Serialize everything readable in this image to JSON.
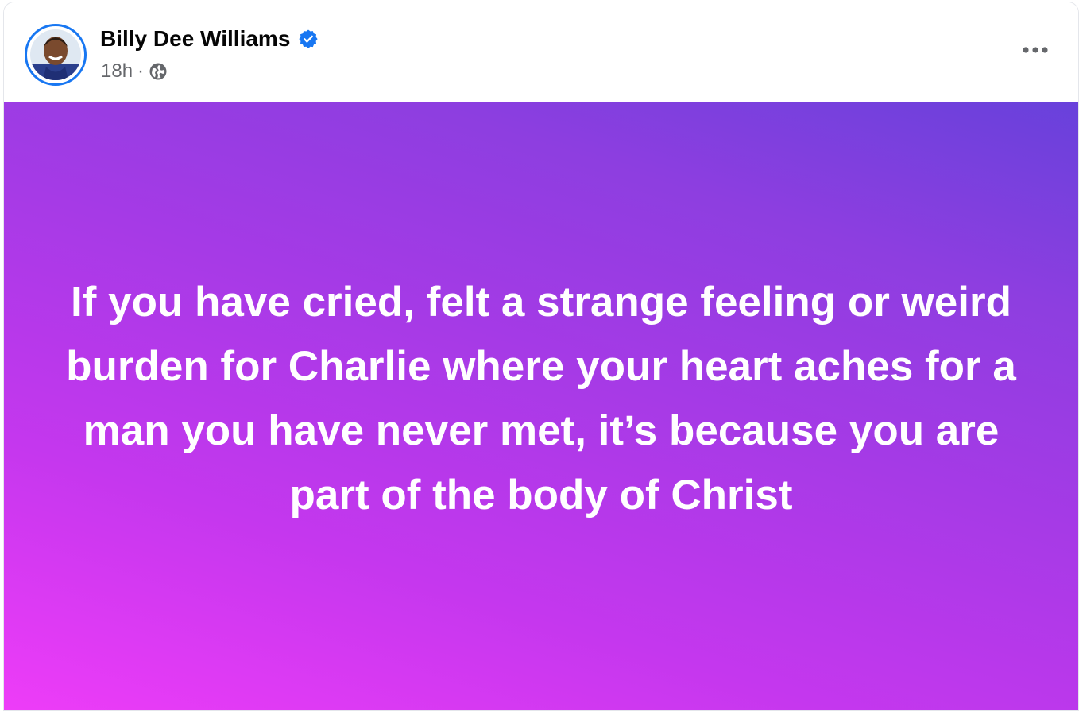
{
  "post": {
    "author": "Billy Dee Williams",
    "verified_icon": "verified-badge-icon",
    "time": "18h",
    "separator": "·",
    "audience_icon": "globe-icon",
    "more_icon": "more-options-icon",
    "text": "If you have cried, felt a strange feeling or weird burden for Charlie where your heart aches for a man you have never met, it’s because you are part of the body of Christ"
  },
  "colors": {
    "gradient_start": "#ee3cf8",
    "gradient_end": "#6841db",
    "verified": "#1877f2",
    "avatar_ring": "#1877f2",
    "text_on_background": "#ffffff",
    "meta_text": "#65676b"
  }
}
